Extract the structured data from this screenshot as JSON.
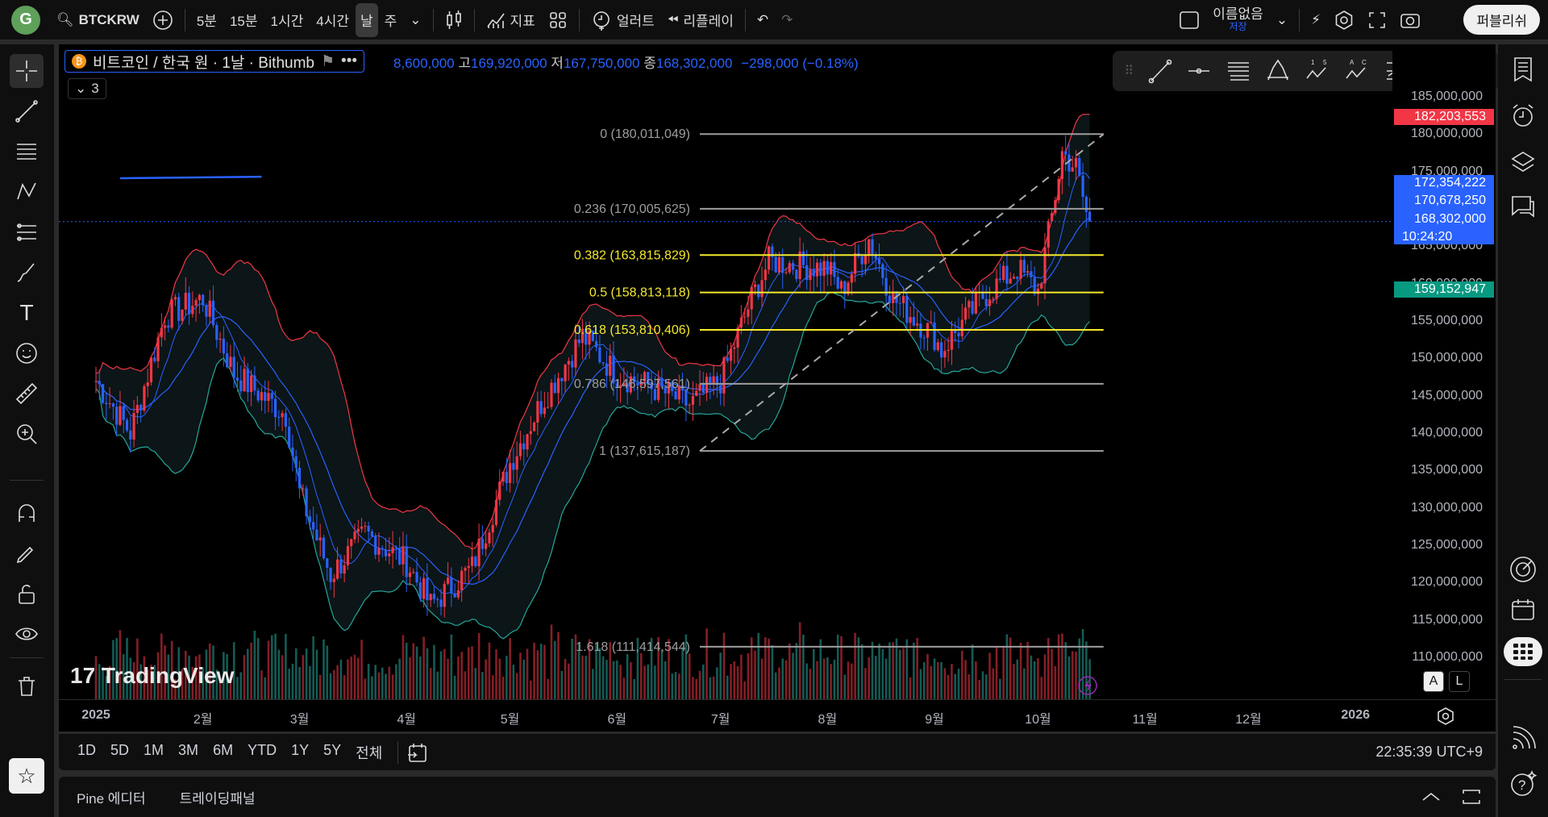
{
  "topbar": {
    "avatar": "G",
    "symbol": "BTCKRW",
    "intervals": [
      "5분",
      "15분",
      "1시간",
      "4시간",
      "날",
      "주"
    ],
    "selected_interval": "날",
    "indicators": "지표",
    "alert": "얼러트",
    "replay": "리플레이",
    "layout_name": "이름없음",
    "save": "저장",
    "publish": "퍼블리쉬"
  },
  "legend": {
    "title": "비트코인 / 한국 원 · 1날 · Bithumb",
    "collapse_count": "3",
    "open_prefix": "",
    "open": "8,600,000",
    "high_label": "고",
    "high": "169,920,000",
    "low_label": "저",
    "low": "167,750,000",
    "close_label": "종",
    "close": "168,302,000",
    "change": "−298,000 (−0.18%)"
  },
  "price_axis": {
    "ticks": [
      185,
      180,
      175,
      165,
      160,
      155,
      150,
      145,
      140,
      135,
      130,
      125,
      120,
      115,
      110
    ],
    "tick_labels": [
      "185,000,000",
      "180,000,000",
      "175,000,000",
      "165,000,000",
      "160,000,000",
      "155,000,000",
      "150,000,000",
      "145,000,000",
      "140,000,000",
      "135,000,000",
      "130,000,000",
      "125,000,000",
      "120,000,000",
      "115,000,000",
      "110,000,000"
    ],
    "bb_upper": "182,203,553",
    "bb_upper_value": 182.2,
    "ma_a": "172,354,222",
    "ma_b": "170,678,250",
    "last": "168,302,000",
    "countdown": "10:24:20",
    "bb_lower": "159,152,947",
    "bb_lower_value": 159.15,
    "auto": "A",
    "log": "L"
  },
  "time_axis": {
    "labels": [
      {
        "t": "2025",
        "day": 0
      },
      {
        "t": "2월",
        "day": 31
      },
      {
        "t": "3월",
        "day": 59
      },
      {
        "t": "4월",
        "day": 90
      },
      {
        "t": "5월",
        "day": 120
      },
      {
        "t": "6월",
        "day": 151
      },
      {
        "t": "7월",
        "day": 181
      },
      {
        "t": "8월",
        "day": 212
      },
      {
        "t": "9월",
        "day": 243
      },
      {
        "t": "10월",
        "day": 273
      },
      {
        "t": "11월",
        "day": 304
      },
      {
        "t": "12월",
        "day": 334
      },
      {
        "t": "2026",
        "day": 365
      }
    ]
  },
  "fib": {
    "levels": [
      {
        "label": "0 (180,011,049)",
        "price": 180.011,
        "color": "#9e9e9e"
      },
      {
        "label": "0.236 (170,005,625)",
        "price": 170.006,
        "color": "#9e9e9e"
      },
      {
        "label": "0.382 (163,815,829)",
        "price": 163.816,
        "color": "#f5e92c"
      },
      {
        "label": "0.5 (158,813,118)",
        "price": 158.813,
        "color": "#f5e92c"
      },
      {
        "label": "0.618 (153,810,406)",
        "price": 153.81,
        "color": "#f5e92c"
      },
      {
        "label": "0.786 (146,597,561)",
        "price": 146.6,
        "color": "#9e9e9e"
      },
      {
        "label": "1 (137,615,187)",
        "price": 137.615,
        "color": "#9e9e9e"
      },
      {
        "label": "1.618 (111,414,544)",
        "price": 111.415,
        "color": "#9e9e9e"
      }
    ],
    "start_day": 175,
    "end_day": 292
  },
  "chart_data": {
    "type": "candlestick",
    "unit": "백만 KRW",
    "price_path": [
      [
        0,
        147
      ],
      [
        10,
        140
      ],
      [
        20,
        155.7
      ],
      [
        31,
        158
      ],
      [
        40,
        148
      ],
      [
        55,
        142.5
      ],
      [
        59,
        132
      ],
      [
        68,
        121
      ],
      [
        78,
        126.6
      ],
      [
        90,
        122.7
      ],
      [
        97,
        117
      ],
      [
        109,
        122
      ],
      [
        120,
        136
      ],
      [
        129,
        144
      ],
      [
        141,
        153
      ],
      [
        151,
        147.8
      ],
      [
        160,
        146.4
      ],
      [
        172,
        143.8
      ],
      [
        181,
        147
      ],
      [
        190,
        158
      ],
      [
        195,
        163
      ],
      [
        212,
        162
      ],
      [
        216,
        159
      ],
      [
        224,
        166
      ],
      [
        231,
        158
      ],
      [
        243,
        153
      ],
      [
        245,
        151
      ],
      [
        257,
        158.3
      ],
      [
        267,
        162
      ],
      [
        273,
        159
      ],
      [
        277,
        169
      ],
      [
        280,
        177.5
      ],
      [
        284,
        175.5
      ],
      [
        287,
        169.5
      ],
      [
        288,
        168.3
      ]
    ],
    "ylim": [
      107,
      187
    ]
  },
  "range_bar": {
    "ranges": [
      "1D",
      "5D",
      "1M",
      "3M",
      "6M",
      "YTD",
      "1Y",
      "5Y",
      "전체"
    ],
    "clock": "22:35:39 UTC+9"
  },
  "bottom_panel": {
    "tabs": [
      "Pine 에디터",
      "트레이딩패널"
    ]
  },
  "watermark": "TradingView",
  "colors": {
    "up": "#f23645",
    "down": "#2962ff",
    "bb_upper": "#f23645",
    "bb_lower": "#26a69a",
    "ma": "#2962ff",
    "vol_up": "#f23645",
    "vol_down": "#26a69a"
  }
}
